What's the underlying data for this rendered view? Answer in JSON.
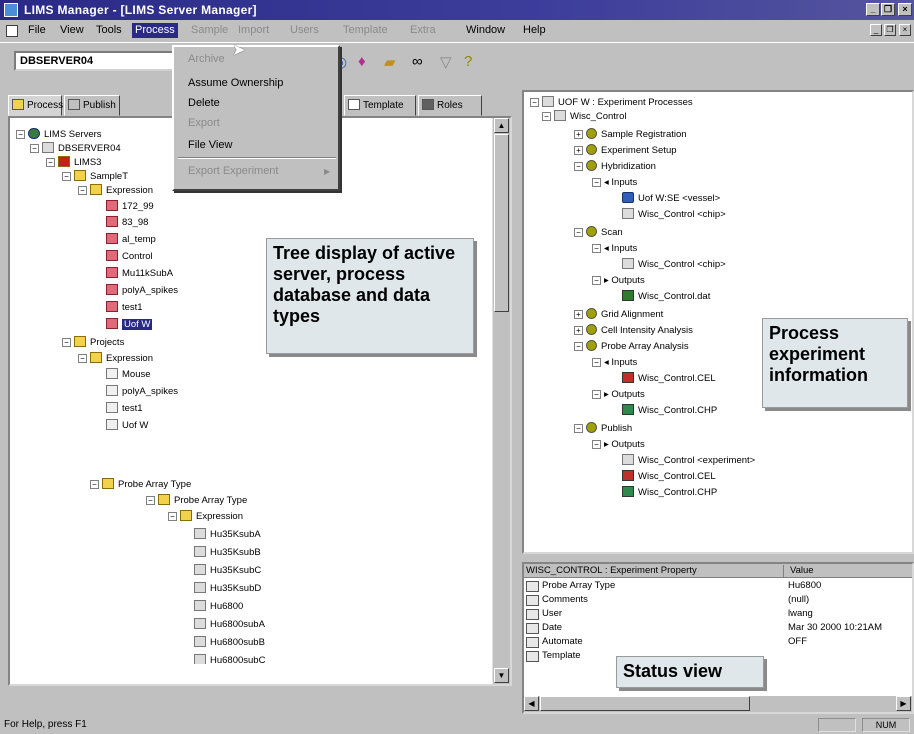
{
  "window": {
    "title": "LIMS Manager - [LIMS Server Manager]"
  },
  "menubar": {
    "items": [
      {
        "label": "File",
        "disabled": false
      },
      {
        "label": "View",
        "disabled": false
      },
      {
        "label": "Tools",
        "disabled": false
      },
      {
        "label": "Process",
        "disabled": false,
        "selected": true
      },
      {
        "label": "Sample",
        "disabled": true
      },
      {
        "label": "Import",
        "disabled": true
      },
      {
        "label": "Users",
        "disabled": true
      },
      {
        "label": "Template",
        "disabled": true
      },
      {
        "label": "Extra",
        "disabled": true
      },
      {
        "label": "Window",
        "disabled": false
      },
      {
        "label": "Help",
        "disabled": false
      }
    ]
  },
  "process_menu": {
    "items": [
      {
        "label": "Archive",
        "disabled": true
      },
      {
        "label": "Assume Ownership",
        "disabled": false
      },
      {
        "label": "Delete",
        "disabled": false
      },
      {
        "label": "Export",
        "disabled": true
      },
      {
        "label": "File View",
        "disabled": false
      },
      {
        "label": "Export Experiment",
        "disabled": true
      }
    ]
  },
  "toolbar": {
    "server_combo": "DBSERVER04"
  },
  "tabs": [
    {
      "label": "Process"
    },
    {
      "label": "Publish"
    },
    {
      "label": "Template"
    },
    {
      "label": "Roles"
    }
  ],
  "left_tree": {
    "root": "LIMS Servers",
    "server": "DBSERVER04",
    "db": "LIMS3",
    "samples_folder": "SampleT",
    "expression_folder": "Expression",
    "samples": [
      "172_99",
      "83_98",
      "al_temp",
      "Control",
      "Mu11kSubA",
      "polyA_spikes",
      "test1",
      "Uof W"
    ],
    "projects_folder": "Projects",
    "projects_expression": "Expression",
    "projects": [
      "Mouse",
      "polyA_spikes",
      "test1",
      "Uof W"
    ],
    "probe_folder": "Probe Array Type",
    "probe_sub": "Probe Array Type",
    "probe_expression": "Expression",
    "probes": [
      "Hu35KsubA",
      "Hu35KsubB",
      "Hu35KsubC",
      "Hu35KsubD",
      "Hu6800",
      "Hu6800subA",
      "Hu6800subB",
      "Hu6800subC"
    ]
  },
  "right_tree": {
    "root": "UOF W : Experiment Processes",
    "control": "Wisc_Control",
    "nodes": {
      "sample_registration": "Sample Registration",
      "experiment_setup": "Experiment Setup",
      "hybridization": "Hybridization",
      "inputs": "Inputs",
      "outputs": "Outputs",
      "uofw_vessel": "Uof W:SE <vessel>",
      "wisc_chip": "Wisc_Control <chip>",
      "scan": "Scan",
      "wisc_dat": "Wisc_Control.dat",
      "grid_alignment": "Grid Alignment",
      "cell_intensity": "Cell Intensity Analysis",
      "probe_array_analysis": "Probe Array Analysis",
      "wisc_cel": "Wisc_Control.CEL",
      "wisc_chp": "Wisc_Control.CHP",
      "publish": "Publish",
      "wisc_experiment": "Wisc_Control <experiment>"
    }
  },
  "property_grid": {
    "header_property": "WISC_CONTROL : Experiment Property",
    "header_value": "Value",
    "rows": [
      {
        "key": "Probe Array Type",
        "value": "Hu6800"
      },
      {
        "key": "Comments",
        "value": "(null)"
      },
      {
        "key": "User",
        "value": "lwang"
      },
      {
        "key": "Date",
        "value": "Mar 30 2000 10:21AM"
      },
      {
        "key": "Automate",
        "value": "OFF"
      },
      {
        "key": "Template",
        "value": ""
      }
    ]
  },
  "callouts": {
    "tree": "Tree display of active server, process database and data types",
    "process": "Process experiment information",
    "status": "Status view"
  },
  "statusbar": {
    "help": "For Help, press F1",
    "num": "NUM"
  }
}
